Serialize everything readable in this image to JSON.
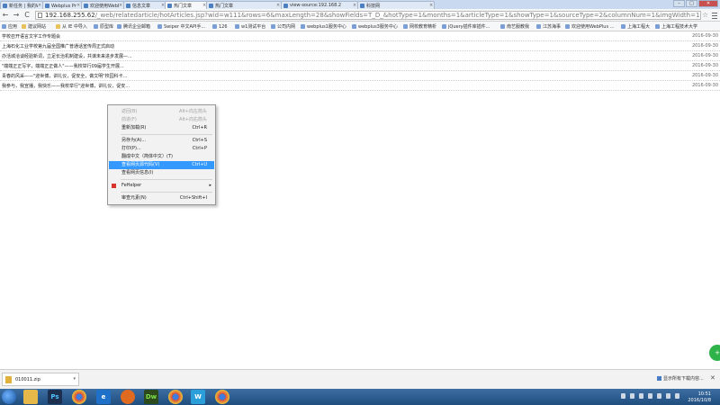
{
  "tabs": [
    {
      "label": "新任务 | 我的Weblogue"
    },
    {
      "label": "Webplus Pro站点入口"
    },
    {
      "label": "欢迎使用WebPlus Pro"
    },
    {
      "label": "信息文章"
    },
    {
      "label": "热门文章"
    },
    {
      "label": "热门文章"
    },
    {
      "label": "view-source:192.168.2"
    },
    {
      "label": "科技网"
    }
  ],
  "window_controls": {
    "minimize": "–",
    "maximize": "□",
    "close": "✕"
  },
  "nav": {
    "back": "←",
    "forward": "→",
    "reload": "C"
  },
  "address_bar": {
    "host": "192.168.255.62",
    "path": "/_web/relatedarticle/hotArticles.jsp?wid=w111&rows=6&maxLength=28&showFields=T_D_&hotType=1&months=1&articleType=1&showType=1&sourceType=2&columnNum=1&imgWidth=160&imgHeight"
  },
  "bookmarks": [
    {
      "label": "应用"
    },
    {
      "label": "建议网站"
    },
    {
      "label": "从 IE 中导入"
    },
    {
      "label": "原型库"
    },
    {
      "label": "腾讯企业邮箱"
    },
    {
      "label": "Swiper 中文API手..."
    },
    {
      "label": "126"
    },
    {
      "label": "w1测试平台"
    },
    {
      "label": "公司内网"
    },
    {
      "label": "webplus1服务中心"
    },
    {
      "label": "webplus3服务中心"
    },
    {
      "label": "网校教育精析"
    },
    {
      "label": "jQuery插件库插件..."
    },
    {
      "label": "南艺服教我"
    },
    {
      "label": "江苏海事"
    },
    {
      "label": "欢迎使用WebPlus ..."
    },
    {
      "label": "上海工程大"
    },
    {
      "label": "上海工程技术大学"
    }
  ],
  "articles": [
    {
      "title": "学校召开语言文字工作专题会",
      "date": "2016-09-30"
    },
    {
      "title": "上海石化工业学校第九届全国推广普通话宣传周正式启动",
      "date": "2016-09-30"
    },
    {
      "title": "办活城洽谈经验新词，立足长治机制建设，共谋未来进步发展—...",
      "date": "2016-09-30"
    },
    {
      "title": "\"端端正正写字，端端正正做人\"——我校举行09届学生开展...",
      "date": "2016-09-30"
    },
    {
      "title": "青春的风采——\"迎世博，讲礼仪，促安全，做文明\"校园科卡...",
      "date": "2016-09-30"
    },
    {
      "title": "我参与，我宣播，我快乐——我校举行\"迎世博，讲礼仪，促安...",
      "date": "2016-09-30"
    }
  ],
  "context_menu": {
    "items": [
      {
        "label": "返回(B)",
        "shortcut": "Alt+向左箭头",
        "disabled": true
      },
      {
        "label": "前进(F)",
        "shortcut": "Alt+向右箭头",
        "disabled": true
      },
      {
        "label": "重新加载(R)",
        "shortcut": "Ctrl+R",
        "disabled": false
      },
      {
        "label": "另存为(A)...",
        "shortcut": "Ctrl+S",
        "disabled": false
      },
      {
        "label": "打印(P)...",
        "shortcut": "Ctrl+P",
        "disabled": false
      },
      {
        "label": "翻成中文（简体中文）(T)",
        "shortcut": "",
        "disabled": false
      },
      {
        "label": "查看网页源代码(V)",
        "shortcut": "Ctrl+U",
        "disabled": false,
        "highlighted": true
      },
      {
        "label": "查看网页信息(I)",
        "shortcut": "",
        "disabled": false
      },
      {
        "label": "FeHelper",
        "shortcut": "",
        "disabled": false,
        "submenu": true
      },
      {
        "label": "审查元素(N)",
        "shortcut": "Ctrl+Shift+I",
        "disabled": false
      }
    ],
    "submenu_arrow": "▸"
  },
  "floating_button": {
    "label": "+"
  },
  "download_bar": {
    "file_name": "010011.zip",
    "dropdown": "▾",
    "show_all": "显示所有下载内容...",
    "close": "✕"
  },
  "taskbar": {
    "apps": [
      {
        "label": "",
        "icon": "explorer-icon",
        "color": "#e6b84a"
      },
      {
        "label": "Ps",
        "icon": "photoshop-icon",
        "color": "#1c2f4f"
      },
      {
        "label": "",
        "icon": "chrome-icon",
        "color": "#d9a52b"
      },
      {
        "label": "e",
        "icon": "ie-icon",
        "color": "#1e70c8"
      },
      {
        "label": "",
        "icon": "firefox-icon",
        "color": "#e06a1f"
      },
      {
        "label": "Dw",
        "icon": "dreamweaver-icon",
        "color": "#2d4a1c"
      },
      {
        "label": "",
        "icon": "chrome-icon",
        "color": "#d9a52b"
      },
      {
        "label": "W",
        "icon": "webplus-icon",
        "color": "#2a9fd9"
      },
      {
        "label": "",
        "icon": "chrome-icon",
        "color": "#d9a52b"
      }
    ],
    "time": "10:51",
    "date": "2016/10/8"
  },
  "colors": {
    "highlight": "#3399ff",
    "green_button": "#2eb34a",
    "taskbar": "#1f4d7e"
  }
}
